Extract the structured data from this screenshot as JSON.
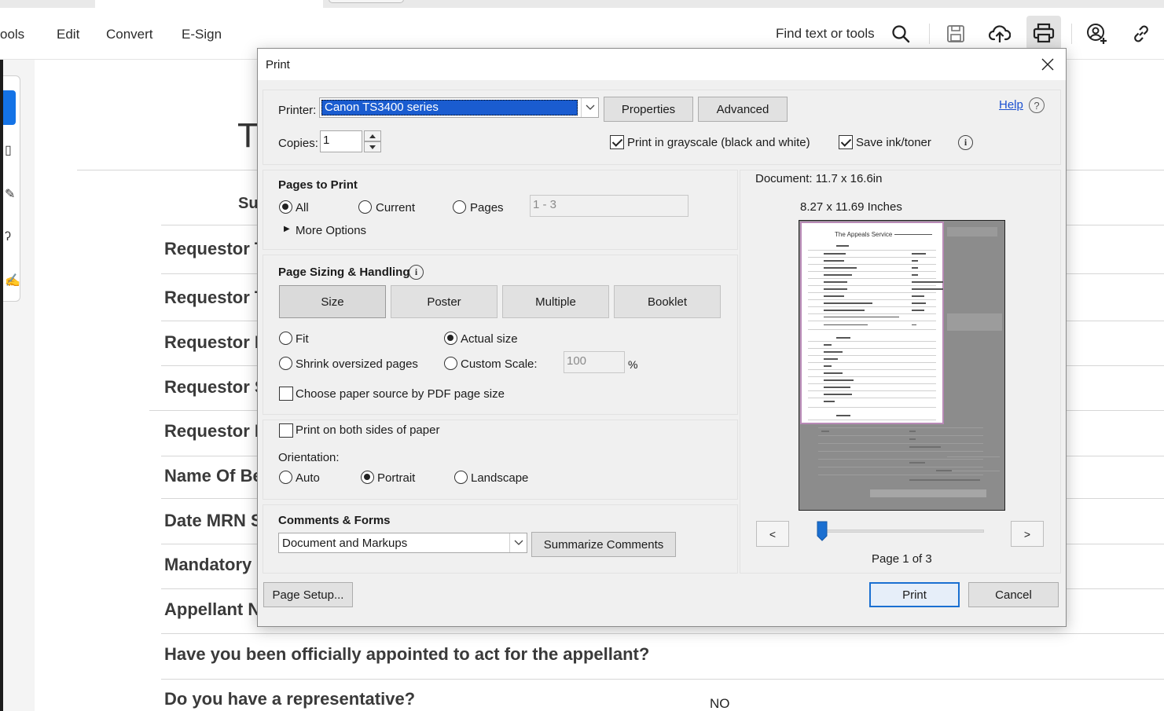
{
  "app": {
    "menu": {
      "tools": "ools",
      "edit": "Edit",
      "convert": "Convert",
      "esign": "E-Sign"
    },
    "find_label": "Find text or tools",
    "toolbar_icons": [
      "search-icon",
      "save-icon",
      "upload-cloud-icon",
      "print-icon",
      "add-user-icon",
      "link-icon"
    ]
  },
  "document": {
    "title_char": "T",
    "summary_label": "Su",
    "rows": [
      "Requestor T",
      "Requestor T",
      "Requestor F",
      "Requestor S",
      "Requestor E",
      "Name Of Be",
      "Date MRN S",
      "Mandatory",
      "Appellant N",
      "Have you been officially appointed to act for the appellant?",
      "Do you have a representative?"
    ],
    "representative_value": "NO"
  },
  "dialog": {
    "title": "Print",
    "printer_label": "Printer:",
    "printer_value": "Canon TS3400 series",
    "properties_button": "Properties",
    "advanced_button": "Advanced",
    "help_link": "Help",
    "copies_label": "Copies:",
    "copies_value": "1",
    "grayscale_label": "Print in grayscale (black and white)",
    "grayscale_checked": true,
    "save_ink_label": "Save ink/toner",
    "save_ink_checked": true,
    "pages_to_print": {
      "heading": "Pages to Print",
      "all": "All",
      "current": "Current",
      "pages": "Pages",
      "pages_placeholder": "1 - 3",
      "selected": "All",
      "more_options": "More Options"
    },
    "page_sizing": {
      "heading": "Page Sizing & Handling",
      "tabs": [
        "Size",
        "Poster",
        "Multiple",
        "Booklet"
      ],
      "selected_tab": "Size",
      "fit": "Fit",
      "actual_size": "Actual size",
      "shrink": "Shrink oversized pages",
      "custom_scale": "Custom Scale:",
      "custom_scale_value": "100",
      "percent": "%",
      "selected": "Actual size",
      "paper_source": "Choose paper source by PDF page size",
      "paper_source_checked": false
    },
    "both_sides": "Print on both sides of paper",
    "both_sides_checked": false,
    "orientation": {
      "label": "Orientation:",
      "auto": "Auto",
      "portrait": "Portrait",
      "landscape": "Landscape",
      "selected": "Portrait"
    },
    "comments_forms": {
      "heading": "Comments & Forms",
      "value": "Document and Markups",
      "summarize_button": "Summarize Comments"
    },
    "preview": {
      "document_size": "Document: 11.7 x 16.6in",
      "page_size": "8.27 x 11.69 Inches",
      "page_indicator": "Page 1 of 3",
      "prev": "<",
      "next": ">",
      "current_page": 1,
      "total_pages": 3,
      "thumb_heading": "The Appeals Service"
    },
    "page_setup_button": "Page Setup...",
    "print_button": "Print",
    "cancel_button": "Cancel"
  }
}
